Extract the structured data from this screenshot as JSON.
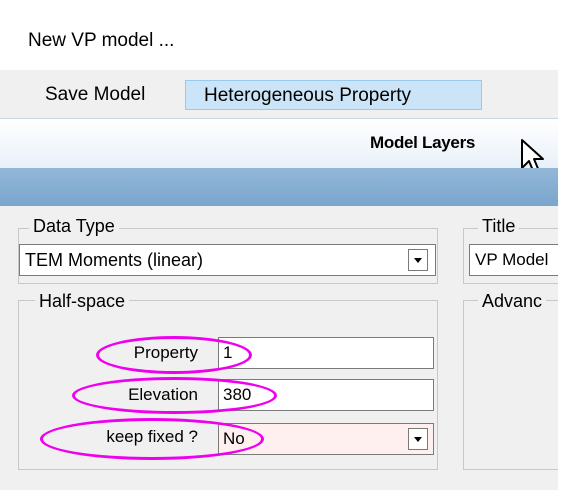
{
  "window": {
    "title": "New VP model ..."
  },
  "menu": {
    "save_model": "Save Model",
    "heterogeneous_property": "Heterogeneous Property"
  },
  "tabs": {
    "model_layers": "Model Layers"
  },
  "data_type": {
    "legend": "Data Type",
    "value": "TEM Moments (linear)"
  },
  "title_group": {
    "legend": "Title",
    "value": "VP Model"
  },
  "half_space": {
    "legend": "Half-space",
    "property_label": "Property",
    "property_value": "1",
    "elevation_label": "Elevation",
    "elevation_value": "380",
    "keep_fixed_label": "keep fixed ?",
    "keep_fixed_value": "No"
  },
  "advanced": {
    "legend": "Advanc"
  },
  "colors": {
    "highlight_ellipse": "#ee00ee",
    "menu_selected": "#cce4f7",
    "keep_fixed_bg": "#fff0f0"
  }
}
